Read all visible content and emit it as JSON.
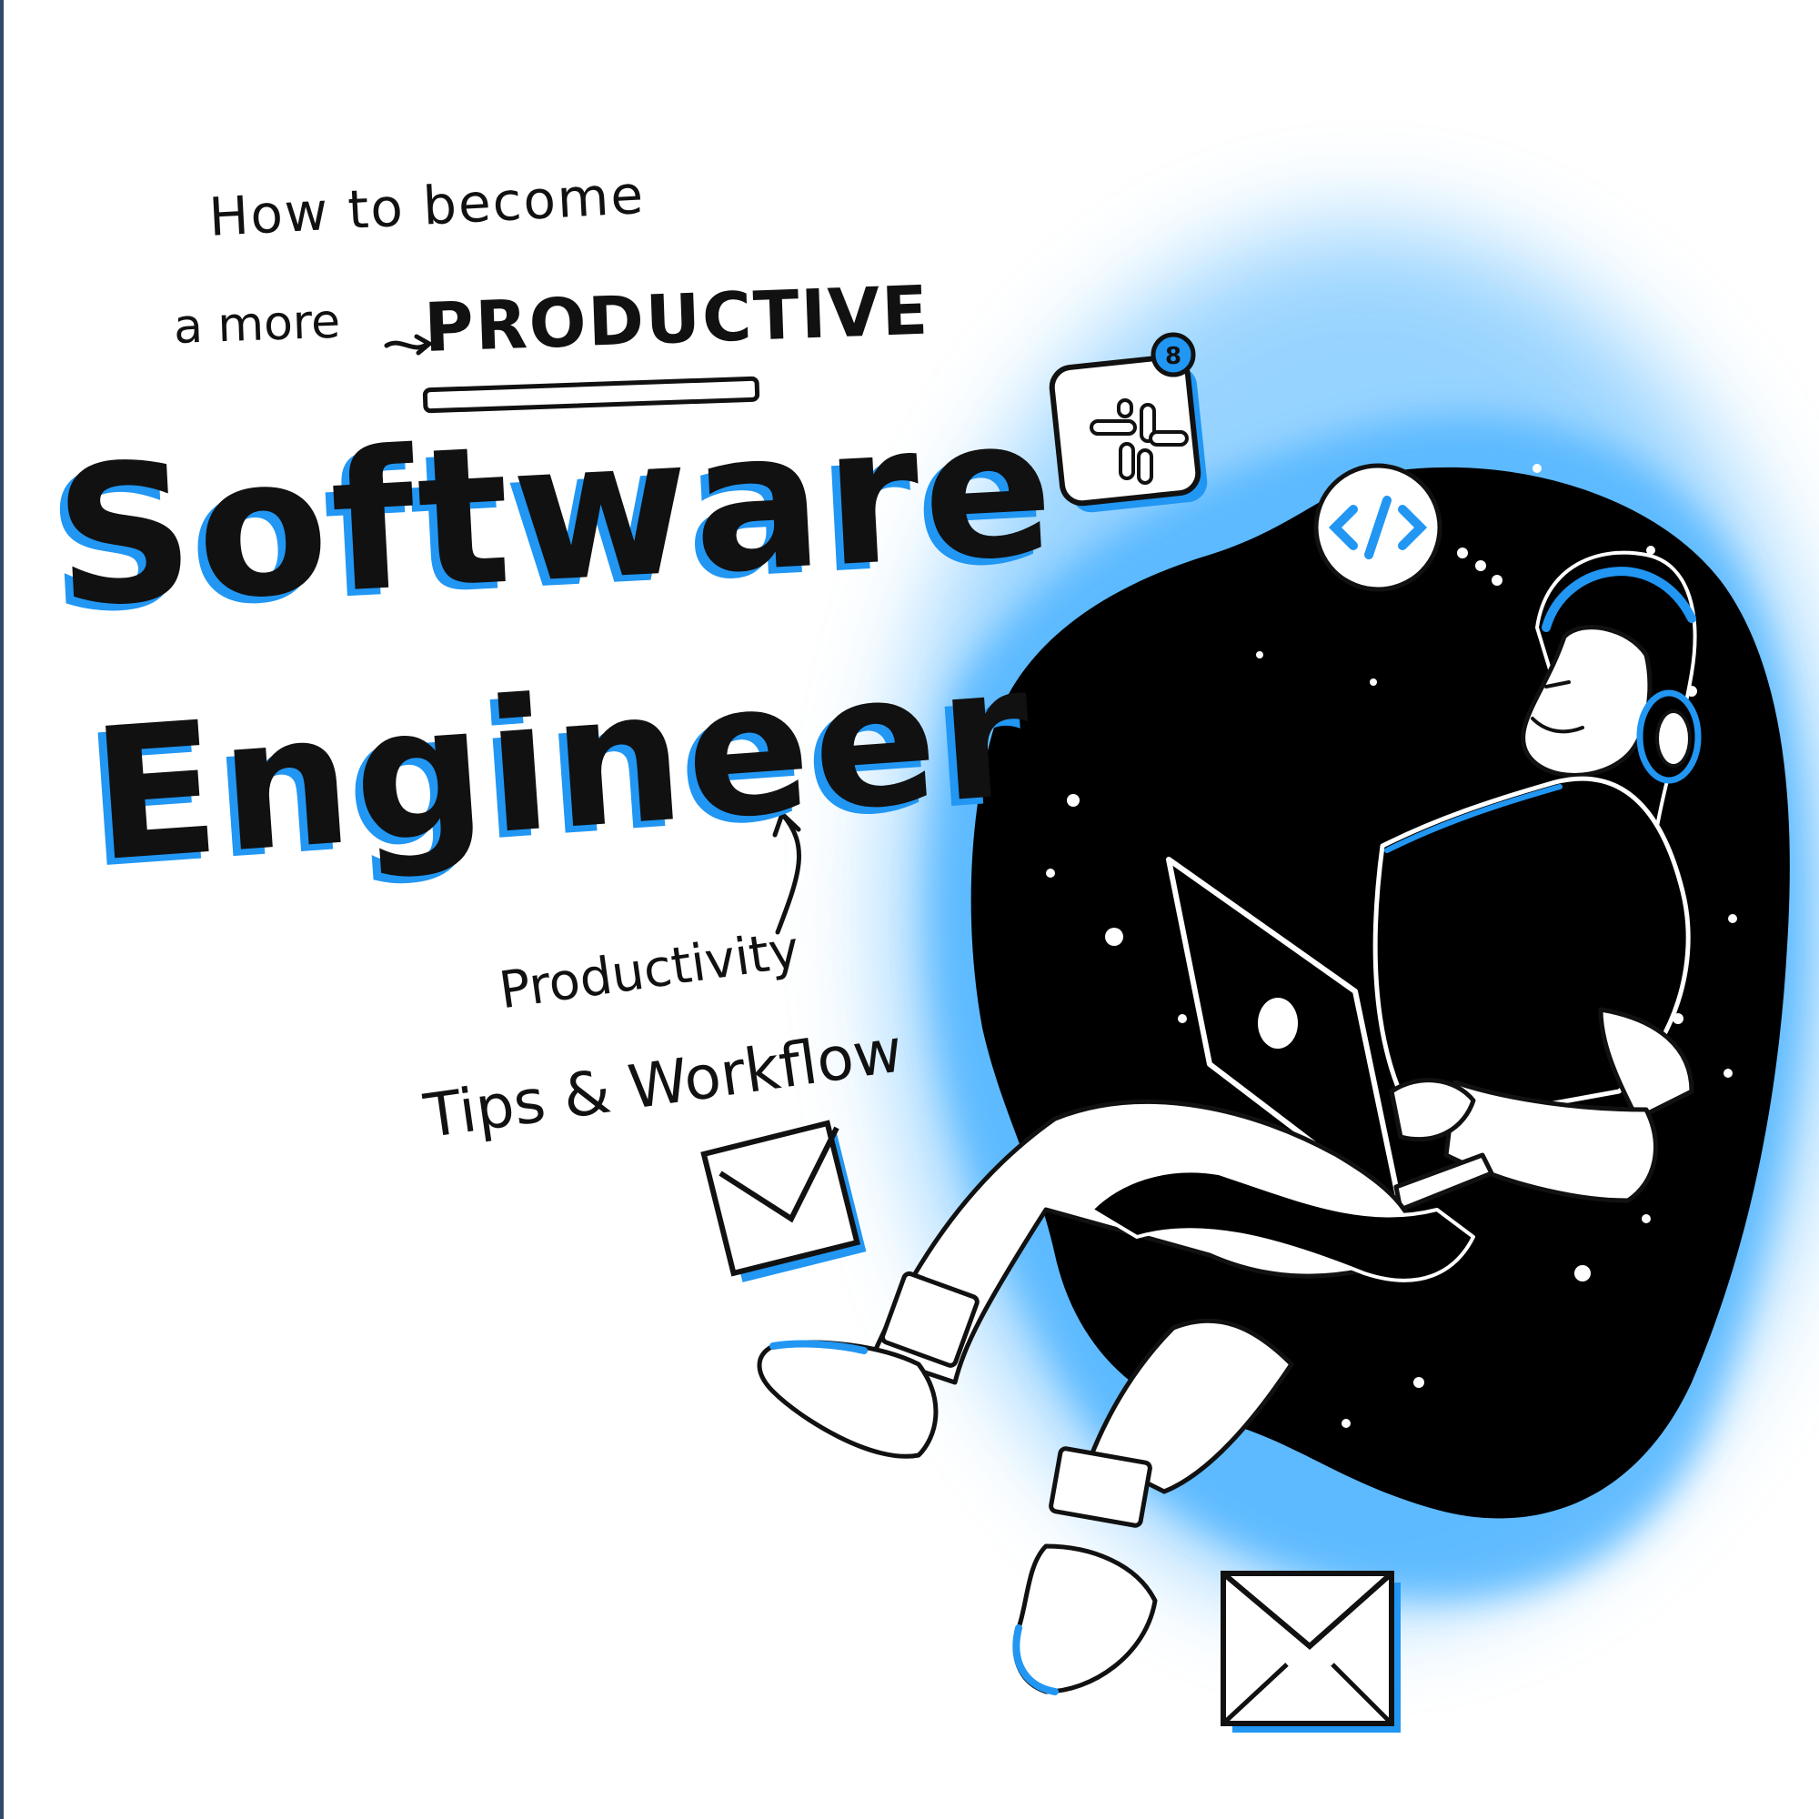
{
  "text": {
    "line1": "How to become",
    "line2": "a more",
    "productive": "PRODUCTIVE",
    "software": "Software",
    "engineer": "Engineer",
    "productivity": "Productivity",
    "tips": "Tips & Workflow"
  },
  "badge": {
    "count": "8"
  },
  "colors": {
    "accent": "#2196f3",
    "ink": "#111111",
    "glow": "#7cc6ff",
    "background": "#ffffff"
  },
  "icons": [
    "slack-icon",
    "code-icon",
    "envelope-icon",
    "laptop-icon",
    "headphones-icon"
  ]
}
